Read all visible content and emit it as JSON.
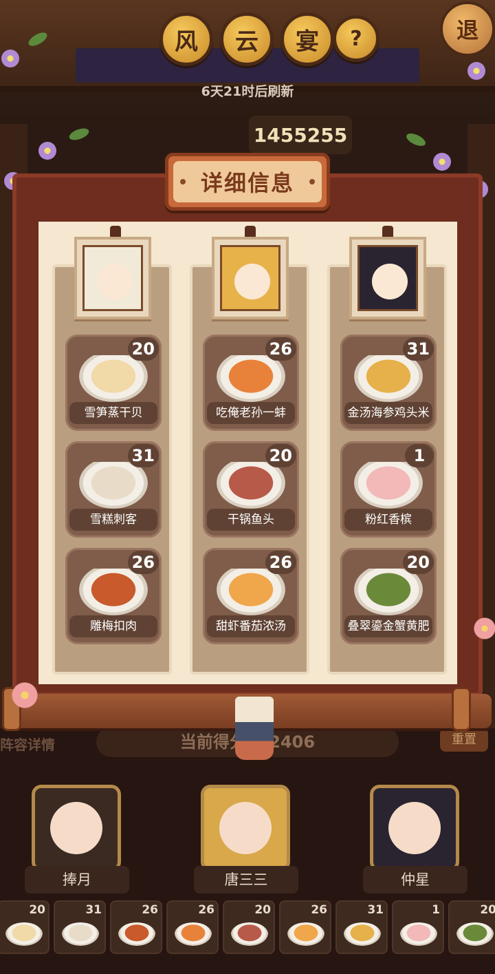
{
  "header": {
    "title_chars": [
      "风",
      "云",
      "宴"
    ],
    "help_label": "?",
    "exit_label": "退",
    "refresh_text": "6天21时后刷新",
    "score": "1455255"
  },
  "modal": {
    "title": "详细信息",
    "columns": [
      {
        "dishes": [
          {
            "count": "20",
            "name": "雪笋蒸干贝",
            "color": "#f1d9a8"
          },
          {
            "count": "31",
            "name": "雪糕刺客",
            "color": "#e8dcc8"
          },
          {
            "count": "26",
            "name": "雕梅扣肉",
            "color": "#c85a2c"
          }
        ]
      },
      {
        "dishes": [
          {
            "count": "26",
            "name": "吃俺老孙一蚌",
            "color": "#e8823a"
          },
          {
            "count": "20",
            "name": "干锅鱼头",
            "color": "#b85a4a"
          },
          {
            "count": "26",
            "name": "甜虾番茄浓汤",
            "color": "#f0a64a"
          }
        ]
      },
      {
        "dishes": [
          {
            "count": "31",
            "name": "金汤海参鸡头米",
            "color": "#e6b04a"
          },
          {
            "count": "1",
            "name": "粉红香槟",
            "color": "#f3b8b8"
          },
          {
            "count": "20",
            "name": "叠翠鎏金蟹黄肥",
            "color": "#6a8a3a"
          }
        ]
      }
    ]
  },
  "lineup": {
    "label": "阵容详情",
    "current_score": "当前得分742406",
    "reset_label": "重置",
    "heroes": [
      "捧月",
      "唐三三",
      "仲星"
    ]
  },
  "dish_bar": [
    {
      "count": "20",
      "color": "#f1d9a8"
    },
    {
      "count": "31",
      "color": "#e8dcc8"
    },
    {
      "count": "26",
      "color": "#c85a2c"
    },
    {
      "count": "26",
      "color": "#e8823a"
    },
    {
      "count": "20",
      "color": "#b85a4a"
    },
    {
      "count": "26",
      "color": "#f0a64a"
    },
    {
      "count": "31",
      "color": "#e6b04a"
    },
    {
      "count": "1",
      "color": "#f3b8b8"
    },
    {
      "count": "20",
      "color": "#6a8a3a"
    }
  ]
}
